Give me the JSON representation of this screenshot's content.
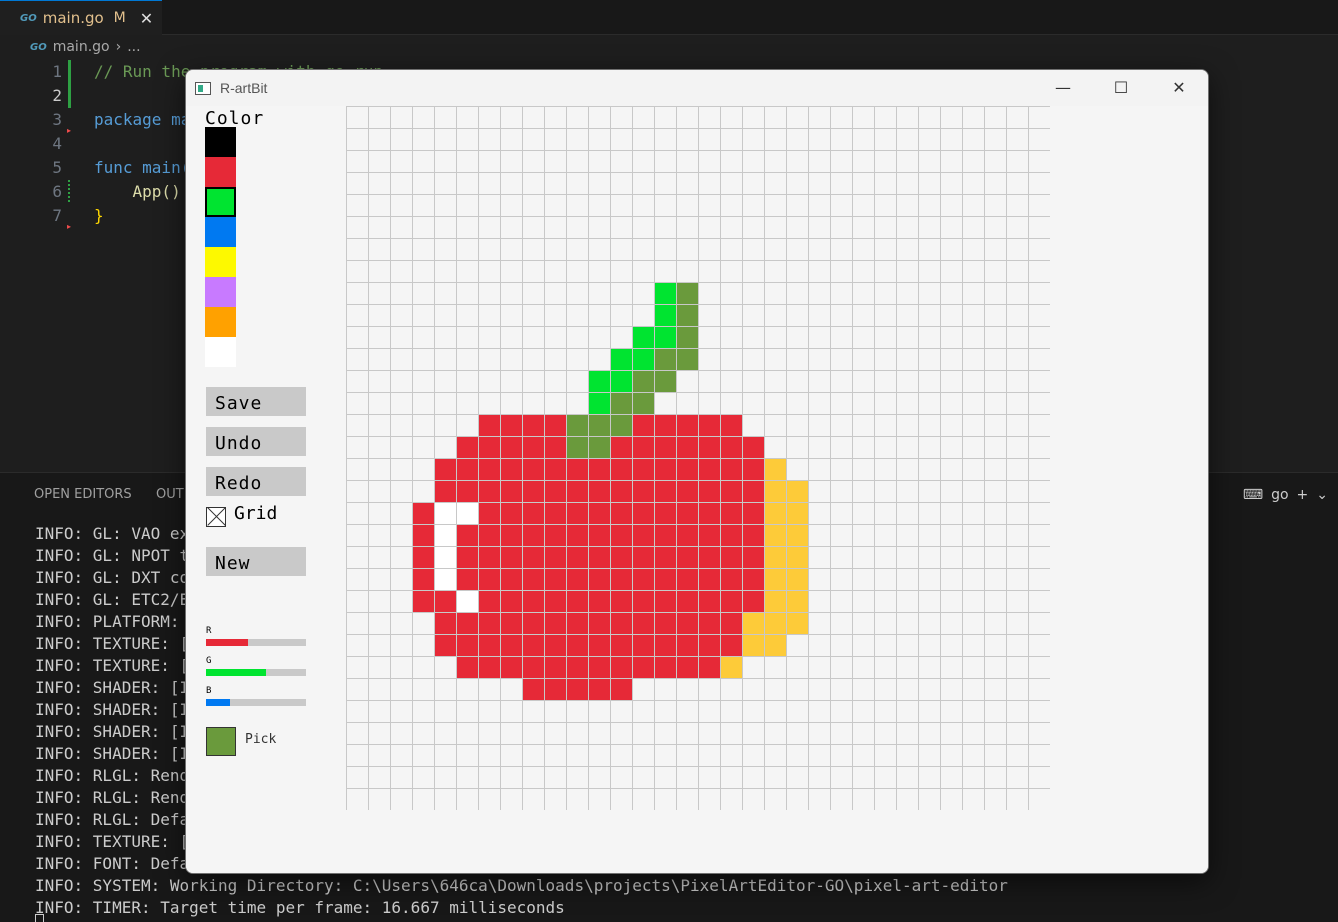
{
  "editor": {
    "tab": {
      "icon": "go-file-icon",
      "go_badge": "GO",
      "filename": "main.go",
      "status": "M",
      "close": "✕"
    },
    "breadcrumb": {
      "file": "main.go",
      "sep": "›",
      "more": "..."
    },
    "lines": [
      {
        "n": "1",
        "text": "// Run the program with go run"
      },
      {
        "n": "2",
        "text": ""
      },
      {
        "n": "3",
        "text": "package main"
      },
      {
        "n": "4",
        "text": ""
      },
      {
        "n": "5",
        "text": "func main() {"
      },
      {
        "n": "6",
        "text": "    App()"
      },
      {
        "n": "7",
        "text": "}"
      }
    ]
  },
  "panel": {
    "tabs": [
      "OPEN EDITORS",
      "OUTLINE"
    ],
    "terminal_name": "go",
    "add": "+",
    "chevron": "⌄",
    "lines": [
      "INFO: GL: VAO extension detected, VAO functions loaded successfully",
      "INFO: GL: NPOT textures extension detected, full NPOT textures supported",
      "INFO: GL: DXT compressed textures supported",
      "INFO: GL: ETC2/EAC compressed textures supported",
      "INFO: PLATFORM: DESKTOP: GLFW - Initialized successfully",
      "INFO: TEXTURE: [ID 1] Default texture loaded successfully",
      "INFO: TEXTURE: [ID 2] Texture loaded successfully",
      "INFO: SHADER: [ID 1] Vertex shader compiled successfully",
      "INFO: SHADER: [ID 2] Fragment shader compiled successfully",
      "INFO: SHADER: [ID 3] Program shader loaded successfully",
      "INFO: SHADER: [ID 3] Default shader loaded successfully",
      "INFO: RLGL: Render batch vertex buffers loaded successfully in RAM (CPU)",
      "INFO: RLGL: Render batch vertex buffers loaded successfully in VRAM (GPU)",
      "INFO: RLGL: Default OpenGL state initialized successfully",
      "INFO: TEXTURE: [ID 2] Texture loaded successfully",
      "INFO: FONT: Default font loaded successfully",
      "INFO: SYSTEM: Working Directory: C:\\Users\\646ca\\Downloads\\projects\\PixelArtEditor-GO\\pixel-art-editor",
      "INFO: TIMER: Target time per frame: 16.667 milliseconds"
    ]
  },
  "app": {
    "title": "R-artBit",
    "window_buttons": {
      "minimize": "—",
      "maximize": "☐",
      "close": "✕"
    },
    "color_label": "Color",
    "palette": [
      "#000000",
      "#e62937",
      "#00e430",
      "#0079f1",
      "#fdf900",
      "#c87aff",
      "#ffa100",
      "#ffffff"
    ],
    "selected_palette_index": 2,
    "buttons": {
      "save": "Save",
      "undo": "Undo",
      "redo": "Redo",
      "new": "New"
    },
    "grid_checkbox": {
      "label": "Grid",
      "checked": true
    },
    "sliders": [
      {
        "label": "R",
        "value": 0.42,
        "color": "#e62937"
      },
      {
        "label": "G",
        "value": 0.6,
        "color": "#00e430"
      },
      {
        "label": "B",
        "value": 0.24,
        "color": "#0079f1"
      }
    ],
    "pick": {
      "label": "Pick",
      "color": "#6a9a3c"
    },
    "canvas": {
      "cols": 32,
      "rows": 32,
      "legend": {
        ".": "#f5f5f5",
        "R": "#e62937",
        "G": "#00e430",
        "O": "#6a9a3c",
        "W": "#ffffff",
        "Y": "#fdcb39"
      },
      "pixels": [
        "................................",
        "................................",
        "................................",
        "................................",
        "................................",
        "................................",
        "................................",
        "................................",
        "..............GO................",
        "..............GO................",
        ".............GGO................",
        "............GGOO................",
        "...........GGOO.................",
        "...........GOO..................",
        "......RRRROOORRRRR..............",
        ".....RRRRROORRRRRRR.............",
        "....RRRRRRRRRRRRRRRY............",
        "....RRRRRRRRRRRRRRRYY...........",
        "...RWWRRRRRRRRRRRRRYY...........",
        "...RWRRRRRRRRRRRRRRYY...........",
        "...RWRRRRRRRRRRRRRRYY...........",
        "...RWRRRRRRRRRRRRRRYY...........",
        "...RRWRRRRRRRRRRRRRYY...........",
        "....RRRRRRRRRRRRRRYYY...........",
        "....RRRRRRRRRRRRRRYY............",
        ".....RRRRRRRRRRRRY..............",
        "........RRRRR...................",
        "................................",
        "................................",
        "................................",
        "................................",
        "................................"
      ]
    }
  }
}
